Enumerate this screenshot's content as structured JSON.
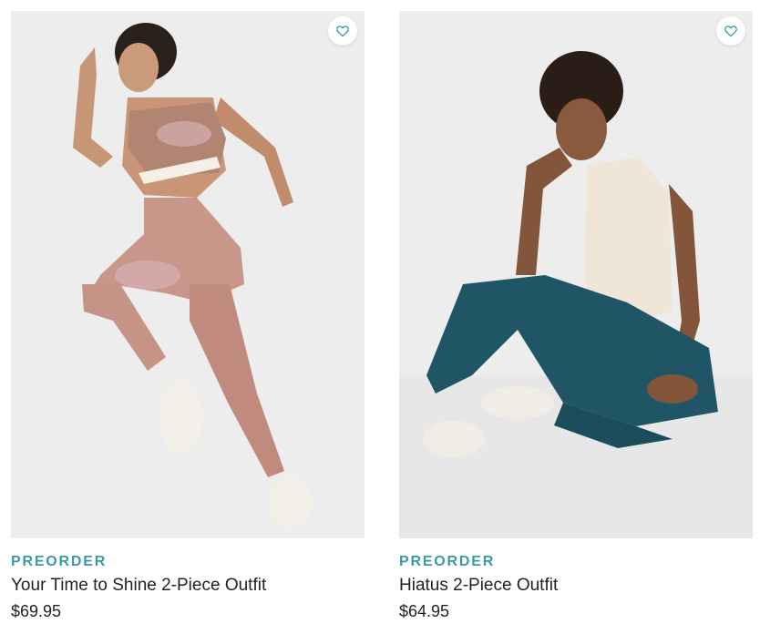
{
  "products": [
    {
      "badge": "PREORDER",
      "name": "Your Time to Shine 2-Piece Outfit",
      "price": "$69.95",
      "wishlist_icon": "heart-outline-icon"
    },
    {
      "badge": "PREORDER",
      "name": "Hiatus 2-Piece Outfit",
      "price": "$64.95",
      "wishlist_icon": "heart-outline-icon"
    }
  ],
  "colors": {
    "accent": "#3a9aa2",
    "text": "#222222",
    "photo_bg": "#ececec"
  }
}
